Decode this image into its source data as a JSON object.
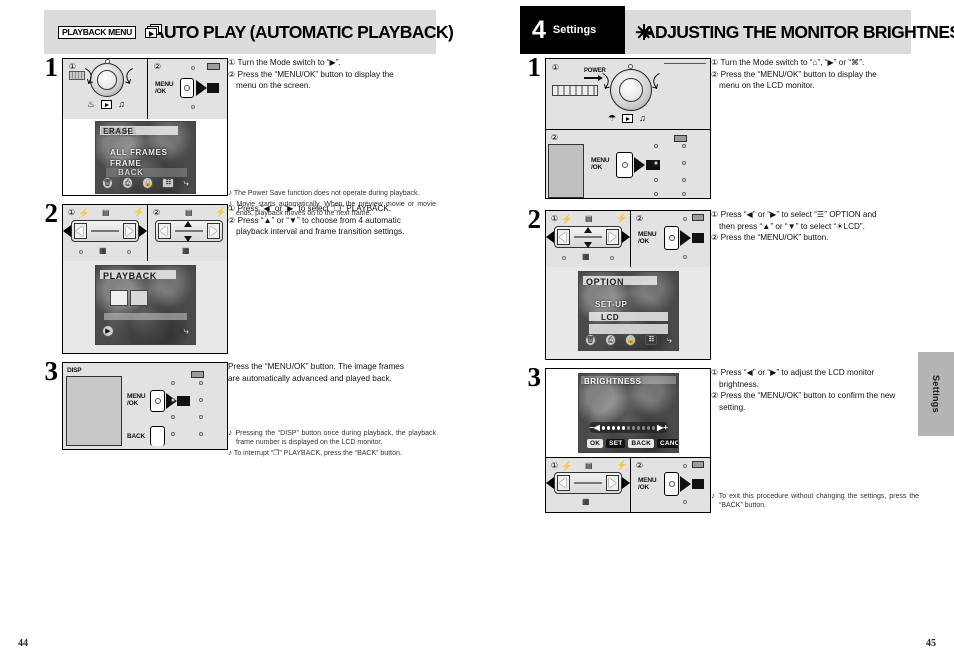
{
  "left_page": {
    "header": {
      "badge": "PLAYBACK MENU",
      "icon": "auto-play-icon",
      "title": "AUTO PLAY (AUTOMATIC PLAYBACK)"
    },
    "page_number": "44",
    "steps": [
      {
        "number": "1",
        "instructions": [
          "① Turn the Mode switch to “▶”.",
          "② Press the “MENU/OK” button to display the",
          "menu on the screen."
        ],
        "notes": [
          "The Power Save function does not operate during playback.",
          "Movie starts automatically. When the preview movie or movie ends, playback moves on to the next frame."
        ],
        "figure": {
          "callout_1": "①",
          "callout_2": "②",
          "button_label": "MENU\n/OK",
          "lcd": {
            "title": "ERASE",
            "items": [
              "ALL FRAMES",
              "FRAME",
              "BACK"
            ],
            "icons": [
              "trash-icon",
              "print-icon",
              "protect-icon",
              "menu-icon"
            ]
          }
        }
      },
      {
        "number": "2",
        "instructions": [
          "① Press “◀” or “▶” to select “❐” PLAYBACK.",
          "② Press “▲” or “▼” to choose from 4 automatic",
          "playback interval and frame transition settings."
        ],
        "figure": {
          "callout_1": "①",
          "callout_2": "②",
          "lcd": {
            "title": "PLAYBACK",
            "items": [],
            "icons": [
              "playback-icon"
            ]
          }
        }
      },
      {
        "number": "3",
        "instructions": [
          "Press the “MENU/OK” button. The image frames",
          "are automatically advanced and played back."
        ],
        "notes": [
          "Pressing the “DISP” button once during playback, the playback frame number is displayed on the LCD monitor.",
          "To interrupt “❐” PLAYBACK, press the “BACK” button."
        ],
        "figure": {
          "disp_label": "DISP",
          "menu_label": "MENU\n/OK",
          "back_label": "BACK"
        }
      }
    ]
  },
  "right_page": {
    "header": {
      "chapter_number": "4",
      "chapter_name": "Settings",
      "icon": "sun-icon",
      "title": "ADJUSTING THE MONITOR BRIGHTNESS"
    },
    "page_number": "45",
    "side_tab": "Settings",
    "steps": [
      {
        "number": "1",
        "instructions": [
          "① Turn the Mode switch to “⌂”, “▶” or “⌘”.",
          "② Press the “MENU/OK” button to display the",
          "menu on the LCD monitor."
        ],
        "figure": {
          "callout_1": "①",
          "callout_2": "②",
          "power_label": "POWER",
          "button_label": "MENU\n/OK"
        }
      },
      {
        "number": "2",
        "instructions": [
          "① Press “◀” or “▶” to select “☰” OPTION and",
          "then press “▲” or “▼” to select “☀LCD”.",
          "② Press the “MENU/OK” button."
        ],
        "figure": {
          "callout_1": "①",
          "callout_2": "②",
          "button_label": "MENU\n/OK",
          "lcd": {
            "title": "OPTION",
            "items": [
              "SET-UP",
              "LCD"
            ],
            "icons": [
              "trash-icon",
              "print-icon",
              "protect-icon",
              "menu-icon"
            ]
          }
        }
      },
      {
        "number": "3",
        "instructions": [
          "① Press “◀” or “▶” to adjust the LCD monitor",
          "brightness.",
          "② Press the “MENU/OK” button to confirm the new",
          "setting."
        ],
        "notes": [
          "To exit this procedure without changing the settings, press the “BACK” button."
        ],
        "figure": {
          "callout_1": "①",
          "callout_2": "②",
          "button_label": "MENU\n/OK",
          "lcd": {
            "title": "BRIGHTNESS",
            "slider_minus": "−◀",
            "slider_plus": "▶+",
            "slider_filled": 5,
            "slider_total": 11,
            "ok_label": "OK",
            "set_label": "SET",
            "back_label": "BACK",
            "cancel_label": "CANCEL"
          }
        }
      }
    ]
  }
}
